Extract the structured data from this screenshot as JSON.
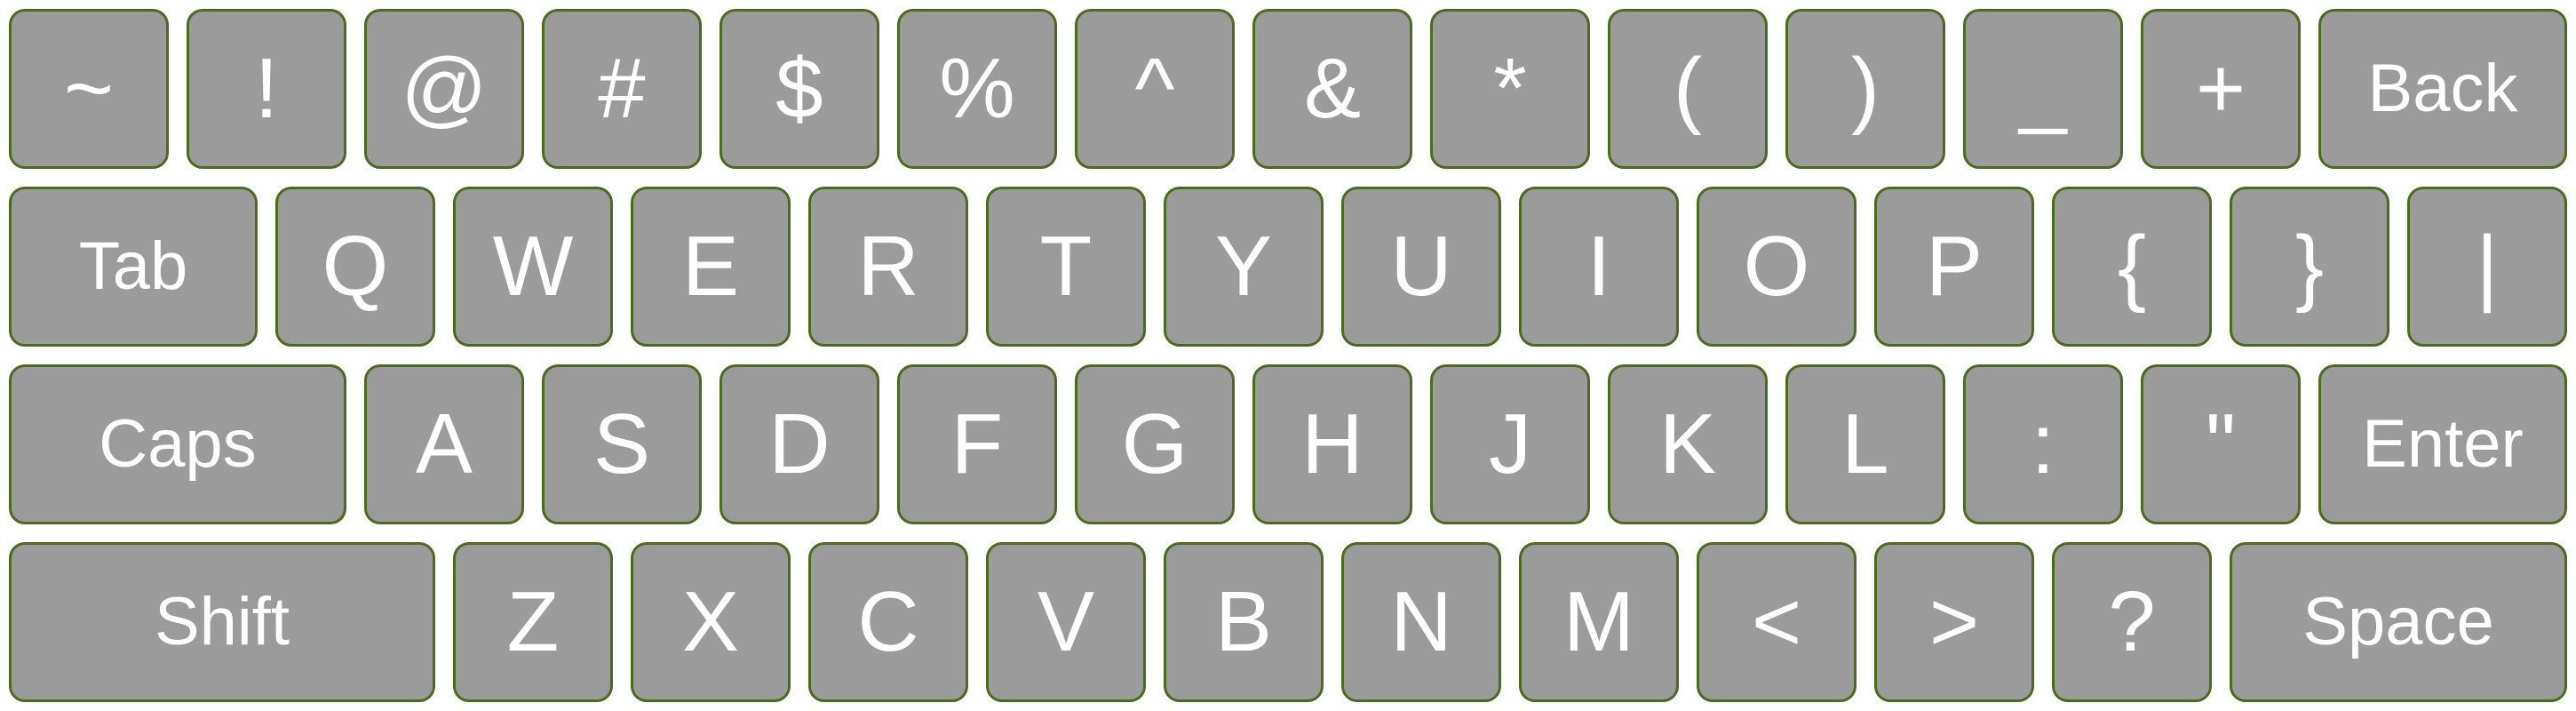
{
  "keyboard": {
    "rows": [
      {
        "keys": [
          {
            "label": "~",
            "name": "key-tilde"
          },
          {
            "label": "!",
            "name": "key-exclamation"
          },
          {
            "label": "@",
            "name": "key-at"
          },
          {
            "label": "#",
            "name": "key-hash"
          },
          {
            "label": "$",
            "name": "key-dollar"
          },
          {
            "label": "%",
            "name": "key-percent"
          },
          {
            "label": "^",
            "name": "key-caret"
          },
          {
            "label": "&",
            "name": "key-ampersand"
          },
          {
            "label": "*",
            "name": "key-asterisk"
          },
          {
            "label": "(",
            "name": "key-left-paren"
          },
          {
            "label": ")",
            "name": "key-right-paren"
          },
          {
            "label": "_",
            "name": "key-underscore"
          },
          {
            "label": "+",
            "name": "key-plus"
          },
          {
            "label": "Back",
            "name": "key-back"
          }
        ]
      },
      {
        "keys": [
          {
            "label": "Tab",
            "name": "key-tab"
          },
          {
            "label": "Q",
            "name": "key-q"
          },
          {
            "label": "W",
            "name": "key-w"
          },
          {
            "label": "E",
            "name": "key-e"
          },
          {
            "label": "R",
            "name": "key-r"
          },
          {
            "label": "T",
            "name": "key-t"
          },
          {
            "label": "Y",
            "name": "key-y"
          },
          {
            "label": "U",
            "name": "key-u"
          },
          {
            "label": "I",
            "name": "key-i"
          },
          {
            "label": "O",
            "name": "key-o"
          },
          {
            "label": "P",
            "name": "key-p"
          },
          {
            "label": "{",
            "name": "key-left-brace"
          },
          {
            "label": "}",
            "name": "key-right-brace"
          },
          {
            "label": "|",
            "name": "key-pipe"
          }
        ]
      },
      {
        "keys": [
          {
            "label": "Caps",
            "name": "key-caps"
          },
          {
            "label": "A",
            "name": "key-a"
          },
          {
            "label": "S",
            "name": "key-s"
          },
          {
            "label": "D",
            "name": "key-d"
          },
          {
            "label": "F",
            "name": "key-f"
          },
          {
            "label": "G",
            "name": "key-g"
          },
          {
            "label": "H",
            "name": "key-h"
          },
          {
            "label": "J",
            "name": "key-j"
          },
          {
            "label": "K",
            "name": "key-k"
          },
          {
            "label": "L",
            "name": "key-l"
          },
          {
            "label": ":",
            "name": "key-colon"
          },
          {
            "label": "\"",
            "name": "key-quote"
          },
          {
            "label": "Enter",
            "name": "key-enter"
          }
        ]
      },
      {
        "keys": [
          {
            "label": "Shift",
            "name": "key-shift"
          },
          {
            "label": "Z",
            "name": "key-z"
          },
          {
            "label": "X",
            "name": "key-x"
          },
          {
            "label": "C",
            "name": "key-c"
          },
          {
            "label": "V",
            "name": "key-v"
          },
          {
            "label": "B",
            "name": "key-b"
          },
          {
            "label": "N",
            "name": "key-n"
          },
          {
            "label": "M",
            "name": "key-m"
          },
          {
            "label": "<",
            "name": "key-less-than"
          },
          {
            "label": ">",
            "name": "key-greater-than"
          },
          {
            "label": "?",
            "name": "key-question"
          },
          {
            "label": "Space",
            "name": "key-space"
          }
        ]
      }
    ]
  }
}
